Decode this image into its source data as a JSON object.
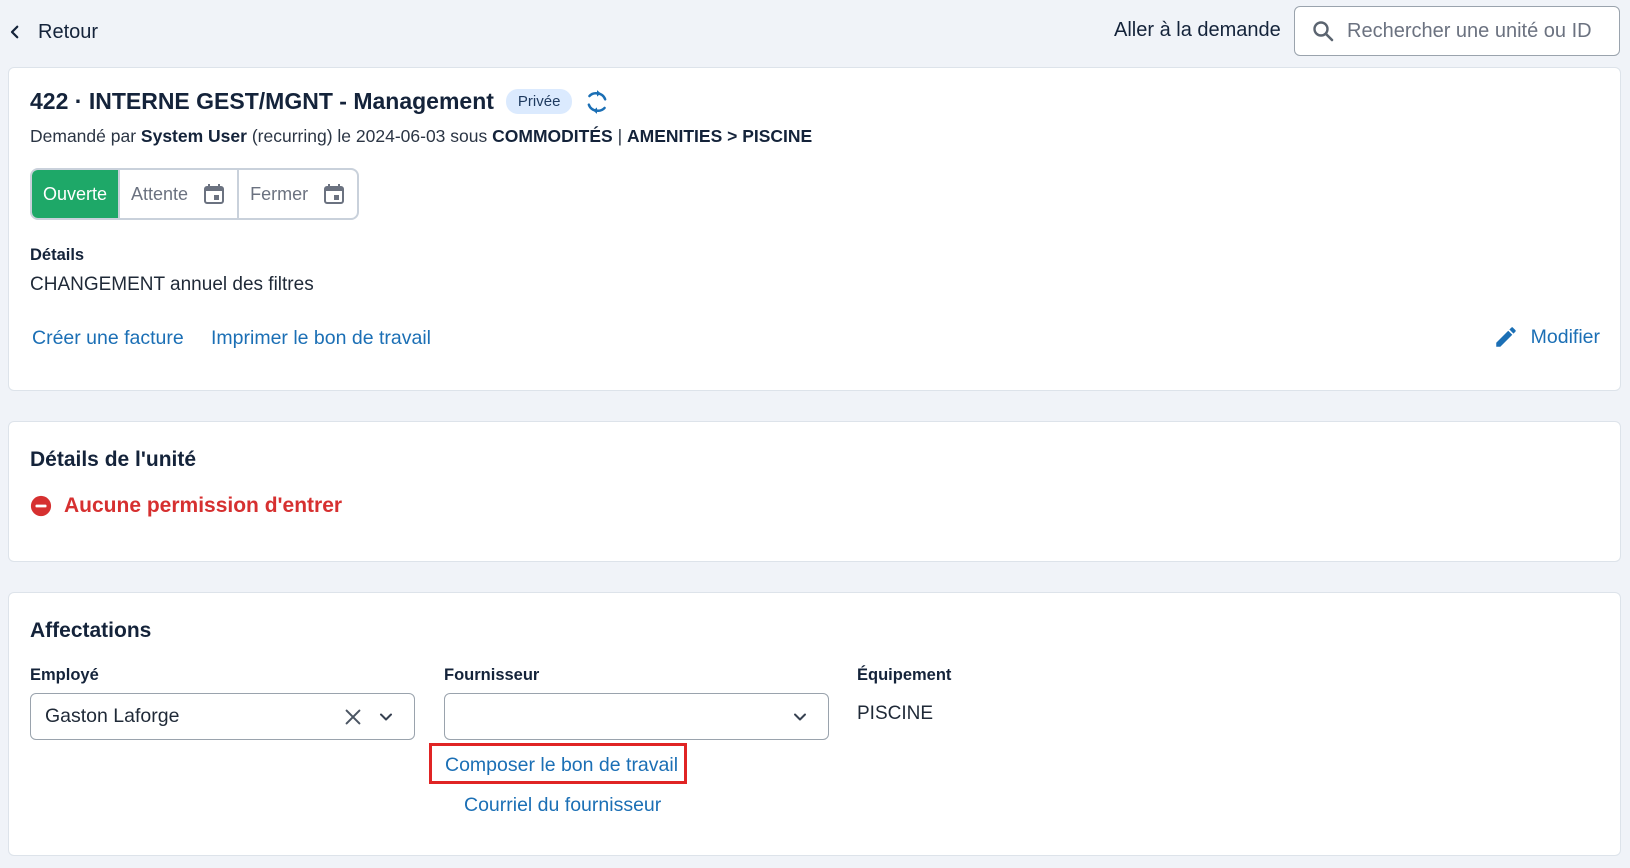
{
  "topbar": {
    "back_label": "Retour",
    "goto_label": "Aller à la demande",
    "search_placeholder": "Rechercher une unité ou ID"
  },
  "request": {
    "title": "422 · INTERNE GEST/MGNT - Management",
    "badge": "Privée",
    "subtitle": {
      "prefix": "Demandé par",
      "user": "System User",
      "mid": "(recurring) le 2024-06-03 sous",
      "category": "COMMODITÉS",
      "sep": "|",
      "path": "AMENITIES > PISCINE"
    },
    "statuses": [
      {
        "label": "Ouverte",
        "active": true
      },
      {
        "label": "Attente",
        "active": false
      },
      {
        "label": "Fermer",
        "active": false
      }
    ],
    "details_label": "Détails",
    "details_text": "CHANGEMENT annuel des filtres",
    "actions": {
      "invoice": "Créer une facture",
      "print": "Imprimer le bon de travail",
      "modify": "Modifier"
    }
  },
  "unit": {
    "title": "Détails de l'unité",
    "permission": "Aucune permission d'entrer"
  },
  "assignments": {
    "title": "Affectations",
    "employee_label": "Employé",
    "employee_value": "Gaston Laforge",
    "supplier_label": "Fournisseur",
    "supplier_value": "",
    "equipment_label": "Équipement",
    "equipment_value": "PISCINE",
    "compose_link": "Composer le bon de travail",
    "email_link": "Courriel du fournisseur"
  },
  "colors": {
    "accent": "#1b6fb5",
    "status_active": "#1ea868",
    "error": "#d63030",
    "highlight_border": "#e02424",
    "background": "#f0f3f8"
  },
  "icons": [
    "chevron-left-icon",
    "search-icon",
    "refresh-icon",
    "calendar-icon",
    "pencil-icon",
    "minus-circle-icon",
    "clear-icon",
    "chevron-down-icon"
  ]
}
